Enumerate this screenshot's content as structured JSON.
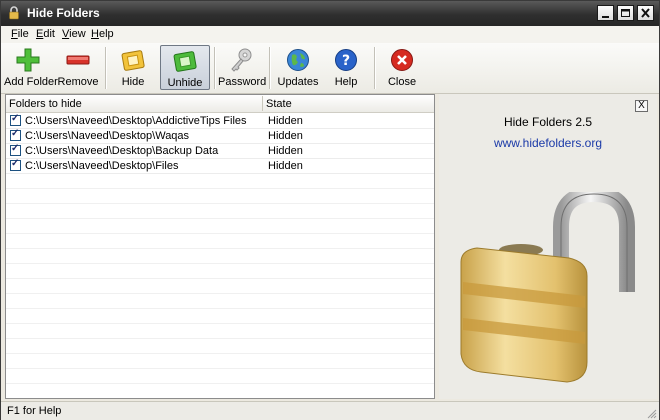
{
  "window": {
    "title": "Hide Folders"
  },
  "menu": [
    {
      "key": "F",
      "rest": "ile"
    },
    {
      "key": "E",
      "rest": "dit"
    },
    {
      "key": "V",
      "rest": "iew"
    },
    {
      "key": "H",
      "rest": "elp"
    }
  ],
  "toolbar": {
    "add_folder": "Add Folder",
    "remove": "Remove",
    "hide": "Hide",
    "unhide": "Unhide",
    "password": "Password",
    "updates": "Updates",
    "help": "Help",
    "close": "Close",
    "active_button": "unhide"
  },
  "list": {
    "columns": [
      "Folders to hide",
      "State"
    ],
    "rows": [
      {
        "checked": true,
        "path": "C:\\Users\\Naveed\\Desktop\\AddictiveTips Files",
        "state": "Hidden"
      },
      {
        "checked": true,
        "path": "C:\\Users\\Naveed\\Desktop\\Waqas",
        "state": "Hidden"
      },
      {
        "checked": true,
        "path": "C:\\Users\\Naveed\\Desktop\\Backup Data",
        "state": "Hidden"
      },
      {
        "checked": true,
        "path": "C:\\Users\\Naveed\\Desktop\\Files",
        "state": "Hidden"
      }
    ]
  },
  "about": {
    "title": "Hide Folders 2.5",
    "url": "www.hidefolders.org",
    "close_glyph": "X"
  },
  "status": {
    "text": "F1 for Help"
  },
  "colors": {
    "link": "#1b3aa8",
    "titlebar": "#2f2f2f"
  }
}
